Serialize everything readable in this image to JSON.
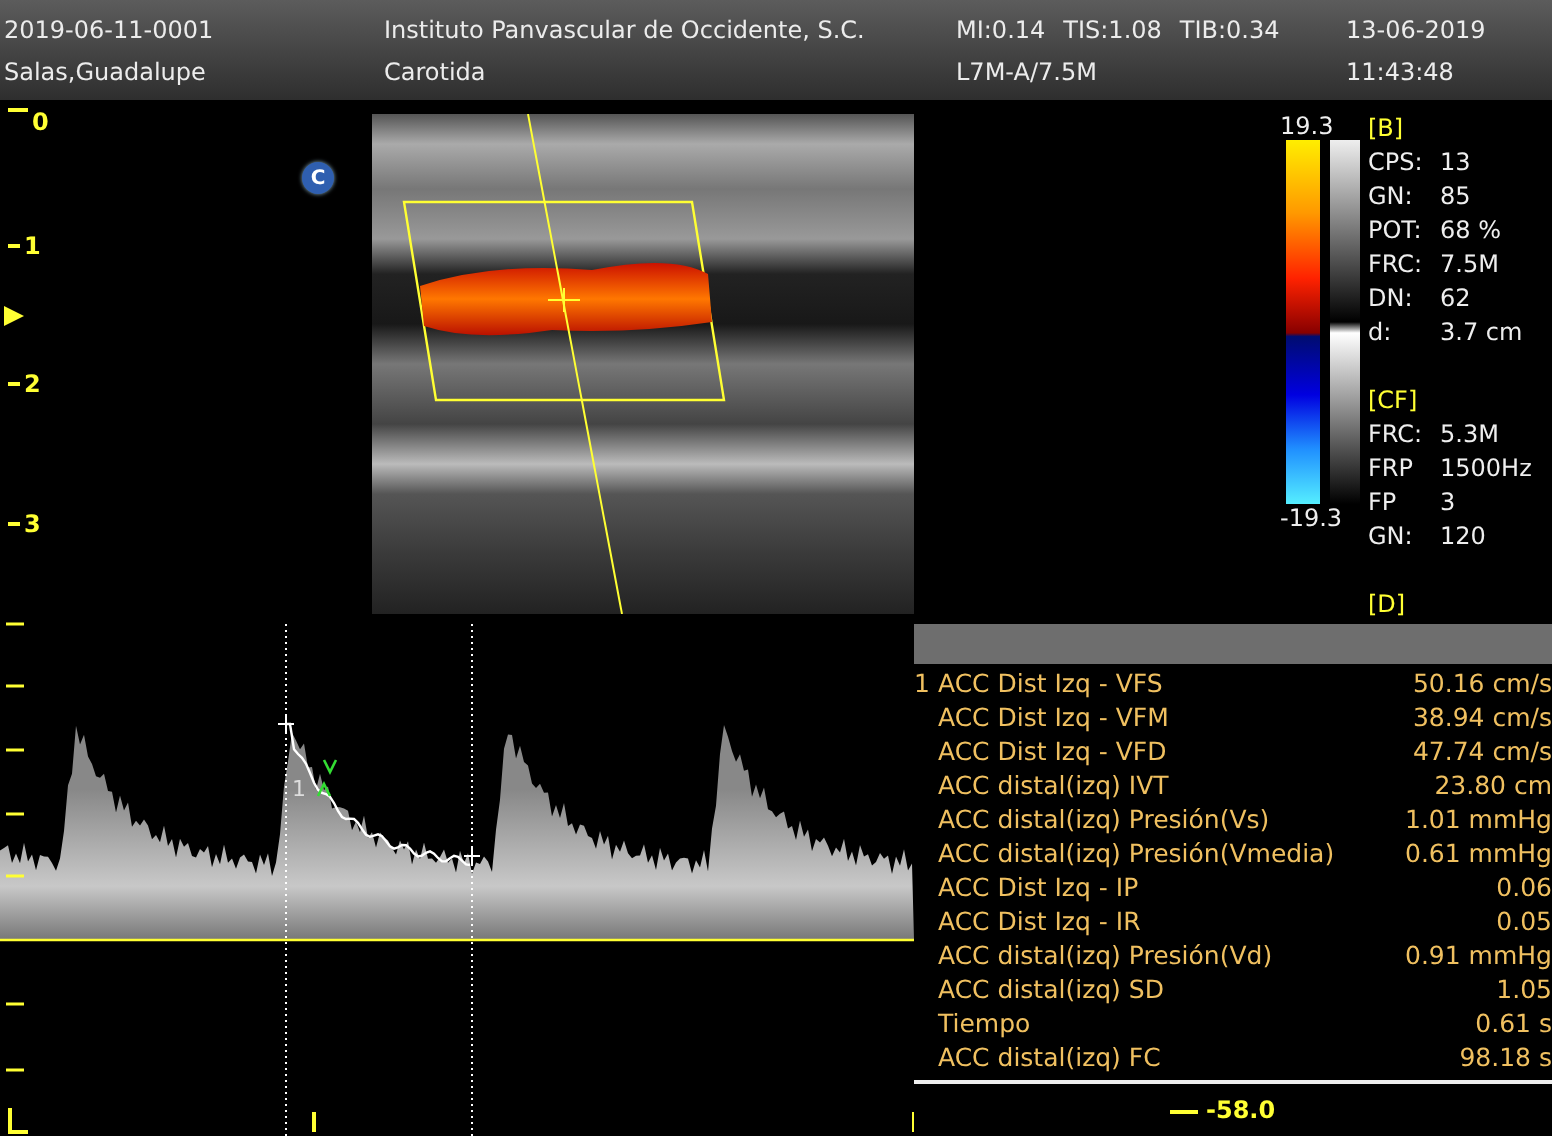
{
  "header": {
    "patient_id": "2019-06-11-0001",
    "institution": "Instituto Panvascular de Occidente, S.C.",
    "indices": [
      "MI:0.14",
      "TIS:1.08",
      "TIB:0.34"
    ],
    "date": "13-06-2019",
    "patient_name": "Salas,Guadalupe",
    "exam": "Carotida",
    "probe": "L7M-A/7.5M",
    "time": "11:43:48"
  },
  "depth_scale": [
    "0",
    "1",
    "2",
    "3"
  ],
  "mode_badge": "C",
  "color_scale": {
    "max": "19.3",
    "min": "-19.3"
  },
  "settings": [
    {
      "title": "[B]",
      "rows": [
        {
          "label": "CPS:",
          "value": "13"
        },
        {
          "label": "GN:",
          "value": "85"
        },
        {
          "label": "POT:",
          "value": "68 %"
        },
        {
          "label": "FRC:",
          "value": "7.5M"
        },
        {
          "label": "DN:",
          "value": "62"
        },
        {
          "label": "d:",
          "value": "3.7 cm"
        }
      ]
    },
    {
      "title": "[CF]",
      "rows": [
        {
          "label": "FRC:",
          "value": "5.3M"
        },
        {
          "label": "FRP",
          "value": "1500Hz"
        },
        {
          "label": "FP",
          "value": "3"
        },
        {
          "label": "GN:",
          "value": "120"
        }
      ]
    },
    {
      "title": "[D]"
    }
  ],
  "spectral": {
    "trace_label": "1",
    "baseline_value": "-58.0"
  },
  "measurements": [
    {
      "index": "1",
      "label": "ACC Dist Izq - VFS",
      "value": "50.16 cm/s"
    },
    {
      "label": "ACC Dist Izq - VFM",
      "value": "38.94 cm/s"
    },
    {
      "label": "ACC Dist Izq - VFD",
      "value": "47.74 cm/s"
    },
    {
      "label": "ACC distal(izq) IVT",
      "value": "23.80 cm"
    },
    {
      "label": "ACC distal(izq) Presión(Vs)",
      "value": "1.01 mmHg"
    },
    {
      "label": "ACC distal(izq) Presión(Vmedia)",
      "value": "0.61 mmHg"
    },
    {
      "label": "ACC Dist Izq - IP",
      "value": "0.06"
    },
    {
      "label": "ACC Dist Izq - IR",
      "value": "0.05"
    },
    {
      "label": "ACC distal(izq) Presión(Vd)",
      "value": "0.91 mmHg"
    },
    {
      "label": "ACC distal(izq) SD",
      "value": "1.05"
    },
    {
      "label": "Tiempo",
      "value": "0.61 s"
    },
    {
      "label": "ACC distal(izq) FC",
      "value": "98.18 s"
    }
  ]
}
